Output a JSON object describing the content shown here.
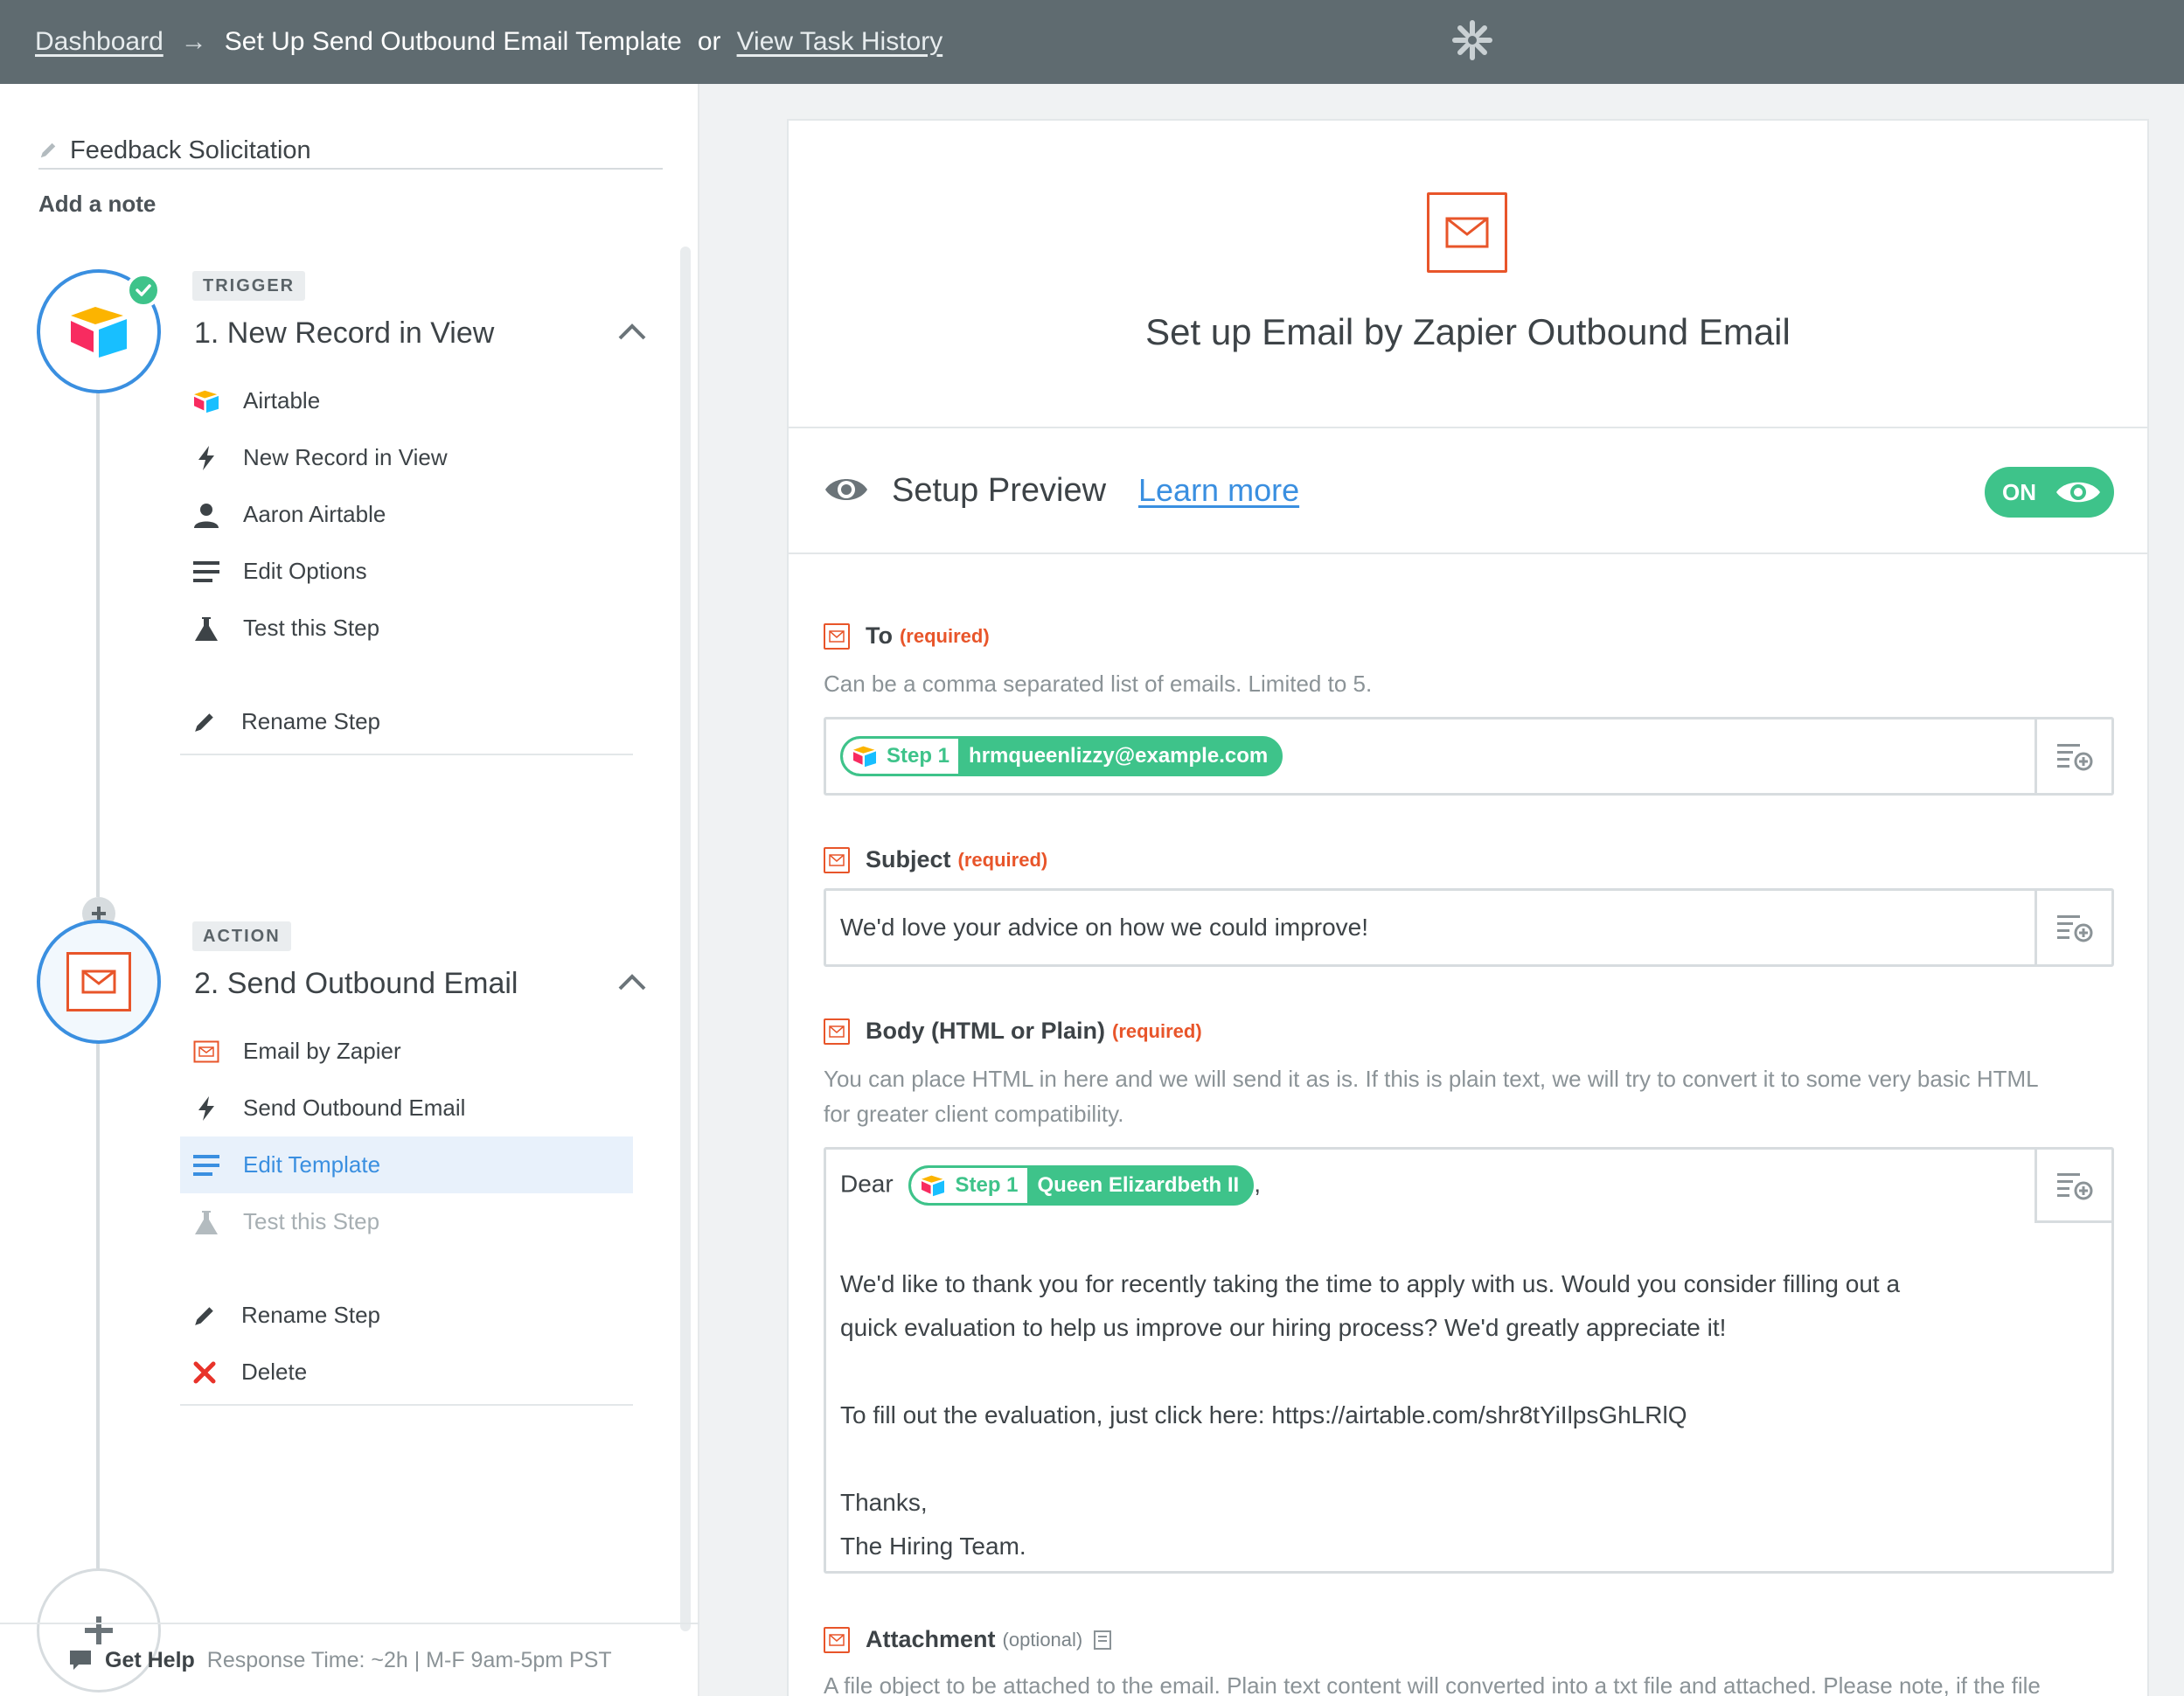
{
  "topbar": {
    "dashboard_link": "Dashboard",
    "arrow": "→",
    "page_title": "Set Up Send Outbound Email Template",
    "or_text": "or",
    "history_link": "View Task History"
  },
  "sidebar": {
    "zap_name": "Feedback Solicitation",
    "add_note": "Add a note",
    "trigger": {
      "tag": "TRIGGER",
      "title": "1. New Record in View",
      "items": [
        {
          "label": "Airtable",
          "icon": "airtable-icon"
        },
        {
          "label": "New Record in View",
          "icon": "bolt-icon"
        },
        {
          "label": "Aaron Airtable",
          "icon": "user-icon"
        },
        {
          "label": "Edit Options",
          "icon": "list-icon"
        },
        {
          "label": "Test this Step",
          "icon": "flask-icon"
        }
      ],
      "rename": "Rename Step"
    },
    "action": {
      "tag": "ACTION",
      "title": "2. Send Outbound Email",
      "items": [
        {
          "label": "Email by Zapier",
          "icon": "mail-icon"
        },
        {
          "label": "Send Outbound Email",
          "icon": "bolt-icon"
        },
        {
          "label": "Edit Template",
          "icon": "list-icon"
        },
        {
          "label": "Test this Step",
          "icon": "flask-icon"
        }
      ],
      "rename": "Rename Step",
      "delete": "Delete"
    },
    "help": {
      "label": "Get Help",
      "response": "Response Time: ~2h  |  M-F 9am-5pm PST"
    }
  },
  "main": {
    "title": "Set up Email by Zapier Outbound Email",
    "preview": {
      "label": "Setup Preview",
      "learn_more": "Learn more",
      "toggle": "ON"
    },
    "fields": {
      "to": {
        "label": "To",
        "required": "(required)",
        "help": "Can be a comma separated list of emails. Limited to 5.",
        "pill_step": "Step 1",
        "pill_value": "hrmqueenlizzy@example.com"
      },
      "subject": {
        "label": "Subject",
        "required": "(required)",
        "value": "We'd love your advice on how we could improve!"
      },
      "body": {
        "label": "Body (HTML or Plain)",
        "required": "(required)",
        "help_line1": "You can place HTML in here and we will send it as is. If this is plain text, we will try to convert it to some very basic HTML",
        "help_line2": "for greater client compatibility.",
        "greeting": "Dear",
        "pill_step": "Step 1",
        "pill_value": "Queen Elizardbeth II",
        "comma": ",",
        "line1": "We'd like to thank you for recently taking the time to apply with us. Would you consider filling out a",
        "line2": "quick evaluation to help us improve our hiring process? We'd greatly appreciate it!",
        "line3": "To fill out the evaluation, just click here: https://airtable.com/shr8tYiIlpsGhLRlQ",
        "line4": "Thanks,",
        "line5": "The Hiring Team."
      },
      "attachment": {
        "label": "Attachment",
        "optional": "(optional)",
        "help": "A file object to be attached to the email. Plain text content will converted into a txt file and attached. Please note, if the file"
      }
    }
  },
  "colors": {
    "accent_blue": "#3a8fe0",
    "green": "#3ec38a",
    "email_orange": "#e8552a",
    "topbar": "#5f6b70"
  }
}
